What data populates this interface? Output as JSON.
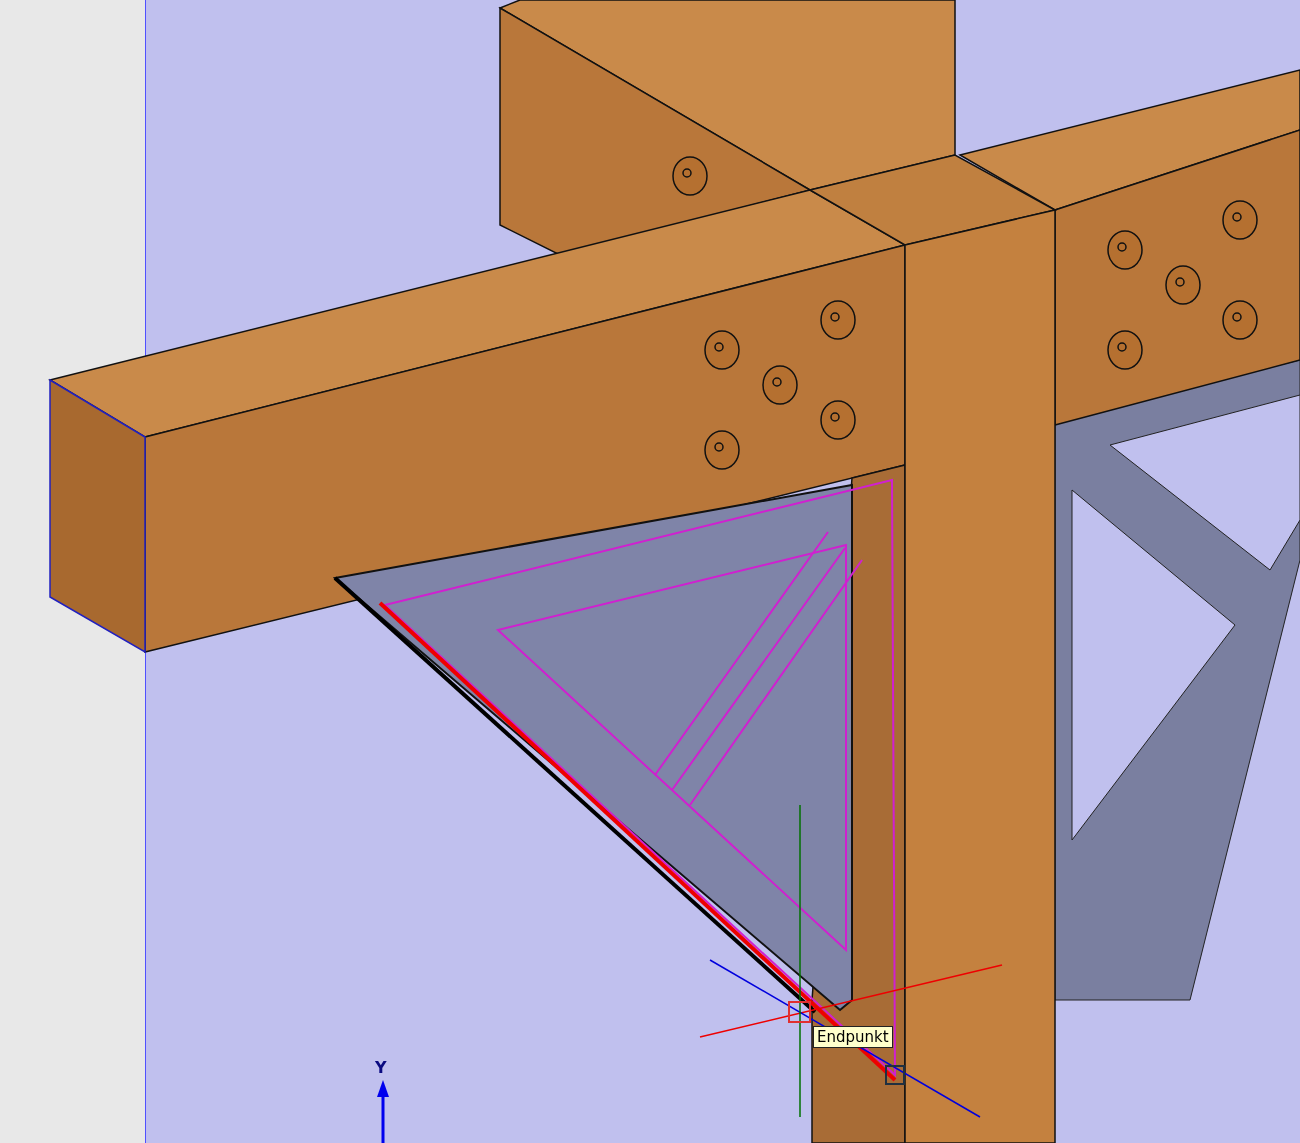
{
  "viewport": {
    "snap_tooltip": "Endpunkt",
    "axis_label": "Y"
  }
}
